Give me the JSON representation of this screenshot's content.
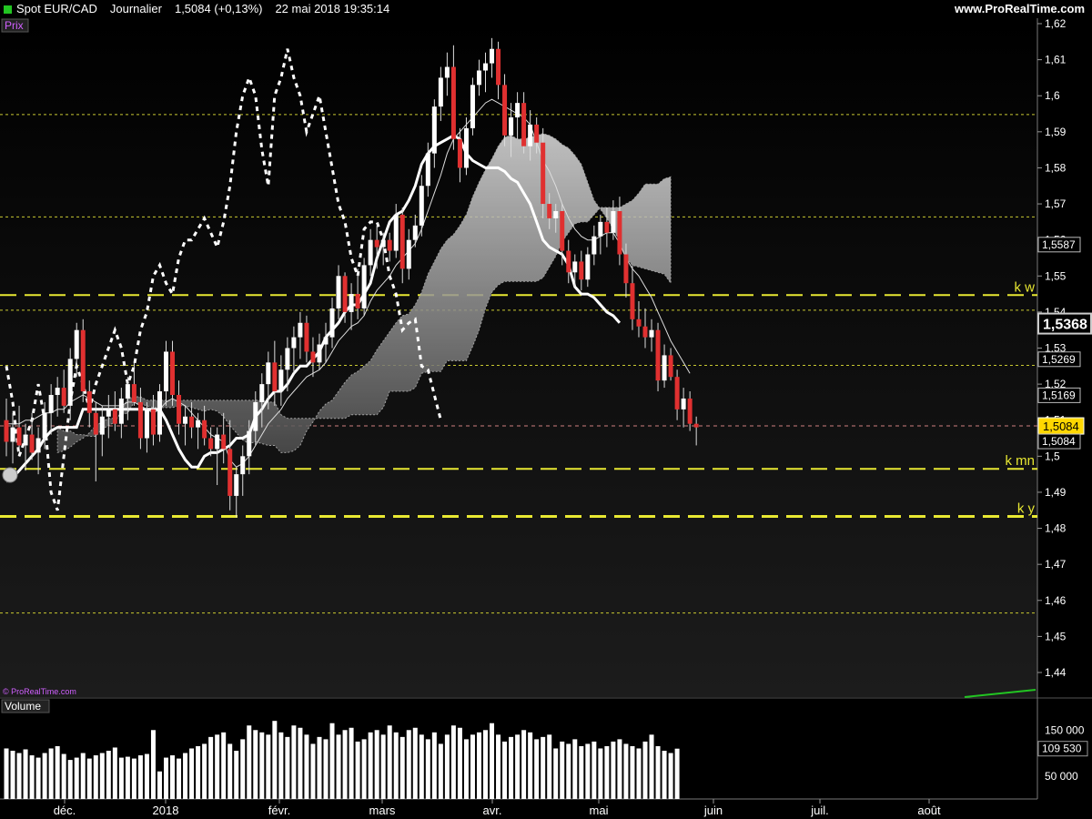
{
  "header": {
    "symbol": "Spot EUR/CAD",
    "period": "Journalier",
    "last": "1,5084 (+0,13%)",
    "datetime": "22 mai 2018 19:35:14",
    "site": "www.ProRealTime.com"
  },
  "panels": {
    "price_label": "Prix",
    "volume_label": "Volume",
    "watermark": "© ProRealTime.com"
  },
  "colors": {
    "background": "#0a0a0a",
    "up": "#ffffff",
    "down": "#e03030",
    "level_line": "#e8e832",
    "accent_green": "#22c522",
    "label_yellow": "#ffd700"
  },
  "chart_data": {
    "type": "line",
    "instrument": "Spot EUR/CAD",
    "x_labels": [
      "déc.",
      "2018",
      "févr.",
      "mars",
      "avr.",
      "mai",
      "juin",
      "juil.",
      "août"
    ],
    "y_ticks": [
      "1,44",
      "1,45",
      "1,46",
      "1,47",
      "1,48",
      "1,49",
      "1,5",
      "1,51",
      "1,52",
      "1,53",
      "1,54",
      "1,55",
      "1,56",
      "1,57",
      "1,58",
      "1,59",
      "1,6",
      "1,61",
      "1,62"
    ],
    "ylim": [
      1.435,
      1.622
    ],
    "price_tags": [
      {
        "text": "1,5587",
        "value": 1.5587,
        "style": "box"
      },
      {
        "text": "1,5368",
        "value": 1.5368,
        "style": "large"
      },
      {
        "text": "1,5269",
        "value": 1.5269,
        "style": "box"
      },
      {
        "text": "1,5169",
        "value": 1.5169,
        "style": "box"
      },
      {
        "text": "1,5084",
        "value": 1.5084,
        "style": "yellow"
      },
      {
        "text": "1,5084",
        "value": 1.5084,
        "style": "box"
      }
    ],
    "levels": [
      {
        "label": "k w",
        "value": 1.5447,
        "style": "dashed-bold"
      },
      {
        "label": "k mn",
        "value": 1.4965,
        "style": "dashed-bold"
      },
      {
        "label": "k y",
        "value": 1.4833,
        "style": "dashed-bold"
      },
      {
        "label": "",
        "value": 1.5948,
        "style": "dotted"
      },
      {
        "label": "",
        "value": 1.5664,
        "style": "dotted"
      },
      {
        "label": "",
        "value": 1.5405,
        "style": "dotted"
      },
      {
        "label": "",
        "value": 1.5252,
        "style": "dotted"
      },
      {
        "label": "",
        "value": 1.4565,
        "style": "dotted"
      }
    ],
    "last_price": 1.5084,
    "candles": [
      {
        "o": 1.51,
        "h": 1.516,
        "l": 1.5,
        "c": 1.504
      },
      {
        "o": 1.504,
        "h": 1.512,
        "l": 1.498,
        "c": 1.508
      },
      {
        "o": 1.508,
        "h": 1.514,
        "l": 1.502,
        "c": 1.503
      },
      {
        "o": 1.503,
        "h": 1.509,
        "l": 1.496,
        "c": 1.506
      },
      {
        "o": 1.506,
        "h": 1.512,
        "l": 1.499,
        "c": 1.501
      },
      {
        "o": 1.501,
        "h": 1.508,
        "l": 1.495,
        "c": 1.505
      },
      {
        "o": 1.505,
        "h": 1.515,
        "l": 1.502,
        "c": 1.512
      },
      {
        "o": 1.512,
        "h": 1.52,
        "l": 1.506,
        "c": 1.517
      },
      {
        "o": 1.517,
        "h": 1.522,
        "l": 1.511,
        "c": 1.519
      },
      {
        "o": 1.519,
        "h": 1.524,
        "l": 1.512,
        "c": 1.514
      },
      {
        "o": 1.514,
        "h": 1.53,
        "l": 1.51,
        "c": 1.527
      },
      {
        "o": 1.527,
        "h": 1.537,
        "l": 1.522,
        "c": 1.535
      },
      {
        "o": 1.535,
        "h": 1.538,
        "l": 1.515,
        "c": 1.518
      },
      {
        "o": 1.518,
        "h": 1.521,
        "l": 1.508,
        "c": 1.512
      },
      {
        "o": 1.512,
        "h": 1.515,
        "l": 1.493,
        "c": 1.506
      },
      {
        "o": 1.506,
        "h": 1.514,
        "l": 1.5,
        "c": 1.511
      },
      {
        "o": 1.511,
        "h": 1.517,
        "l": 1.505,
        "c": 1.513
      },
      {
        "o": 1.513,
        "h": 1.518,
        "l": 1.507,
        "c": 1.509
      },
      {
        "o": 1.509,
        "h": 1.519,
        "l": 1.505,
        "c": 1.516
      },
      {
        "o": 1.516,
        "h": 1.522,
        "l": 1.51,
        "c": 1.52
      },
      {
        "o": 1.52,
        "h": 1.526,
        "l": 1.514,
        "c": 1.515
      },
      {
        "o": 1.515,
        "h": 1.519,
        "l": 1.502,
        "c": 1.505
      },
      {
        "o": 1.505,
        "h": 1.515,
        "l": 1.501,
        "c": 1.513
      },
      {
        "o": 1.513,
        "h": 1.517,
        "l": 1.503,
        "c": 1.506
      },
      {
        "o": 1.506,
        "h": 1.52,
        "l": 1.504,
        "c": 1.518
      },
      {
        "o": 1.518,
        "h": 1.532,
        "l": 1.514,
        "c": 1.529
      },
      {
        "o": 1.529,
        "h": 1.532,
        "l": 1.514,
        "c": 1.517
      },
      {
        "o": 1.517,
        "h": 1.521,
        "l": 1.506,
        "c": 1.509
      },
      {
        "o": 1.509,
        "h": 1.514,
        "l": 1.503,
        "c": 1.511
      },
      {
        "o": 1.511,
        "h": 1.515,
        "l": 1.505,
        "c": 1.508
      },
      {
        "o": 1.508,
        "h": 1.512,
        "l": 1.502,
        "c": 1.51
      },
      {
        "o": 1.51,
        "h": 1.514,
        "l": 1.503,
        "c": 1.505
      },
      {
        "o": 1.505,
        "h": 1.508,
        "l": 1.5,
        "c": 1.502
      },
      {
        "o": 1.502,
        "h": 1.508,
        "l": 1.492,
        "c": 1.506
      },
      {
        "o": 1.506,
        "h": 1.512,
        "l": 1.498,
        "c": 1.502
      },
      {
        "o": 1.502,
        "h": 1.51,
        "l": 1.485,
        "c": 1.489
      },
      {
        "o": 1.489,
        "h": 1.497,
        "l": 1.483,
        "c": 1.495
      },
      {
        "o": 1.495,
        "h": 1.503,
        "l": 1.489,
        "c": 1.5
      },
      {
        "o": 1.5,
        "h": 1.51,
        "l": 1.495,
        "c": 1.507
      },
      {
        "o": 1.507,
        "h": 1.518,
        "l": 1.503,
        "c": 1.515
      },
      {
        "o": 1.515,
        "h": 1.523,
        "l": 1.508,
        "c": 1.52
      },
      {
        "o": 1.52,
        "h": 1.529,
        "l": 1.513,
        "c": 1.526
      },
      {
        "o": 1.526,
        "h": 1.532,
        "l": 1.514,
        "c": 1.518
      },
      {
        "o": 1.518,
        "h": 1.528,
        "l": 1.514,
        "c": 1.524
      },
      {
        "o": 1.524,
        "h": 1.533,
        "l": 1.518,
        "c": 1.53
      },
      {
        "o": 1.53,
        "h": 1.536,
        "l": 1.523,
        "c": 1.533
      },
      {
        "o": 1.533,
        "h": 1.54,
        "l": 1.527,
        "c": 1.537
      },
      {
        "o": 1.537,
        "h": 1.539,
        "l": 1.526,
        "c": 1.529
      },
      {
        "o": 1.529,
        "h": 1.533,
        "l": 1.522,
        "c": 1.526
      },
      {
        "o": 1.526,
        "h": 1.534,
        "l": 1.524,
        "c": 1.531
      },
      {
        "o": 1.531,
        "h": 1.537,
        "l": 1.526,
        "c": 1.533
      },
      {
        "o": 1.533,
        "h": 1.544,
        "l": 1.53,
        "c": 1.541
      },
      {
        "o": 1.541,
        "h": 1.553,
        "l": 1.538,
        "c": 1.55
      },
      {
        "o": 1.55,
        "h": 1.551,
        "l": 1.537,
        "c": 1.54
      },
      {
        "o": 1.54,
        "h": 1.548,
        "l": 1.535,
        "c": 1.545
      },
      {
        "o": 1.545,
        "h": 1.552,
        "l": 1.538,
        "c": 1.541
      },
      {
        "o": 1.541,
        "h": 1.555,
        "l": 1.539,
        "c": 1.553
      },
      {
        "o": 1.553,
        "h": 1.563,
        "l": 1.55,
        "c": 1.56
      },
      {
        "o": 1.56,
        "h": 1.564,
        "l": 1.552,
        "c": 1.558
      },
      {
        "o": 1.558,
        "h": 1.562,
        "l": 1.553,
        "c": 1.56
      },
      {
        "o": 1.56,
        "h": 1.562,
        "l": 1.554,
        "c": 1.557
      },
      {
        "o": 1.557,
        "h": 1.57,
        "l": 1.555,
        "c": 1.567
      },
      {
        "o": 1.567,
        "h": 1.569,
        "l": 1.548,
        "c": 1.552
      },
      {
        "o": 1.552,
        "h": 1.563,
        "l": 1.549,
        "c": 1.56
      },
      {
        "o": 1.56,
        "h": 1.567,
        "l": 1.558,
        "c": 1.564
      },
      {
        "o": 1.564,
        "h": 1.578,
        "l": 1.561,
        "c": 1.575
      },
      {
        "o": 1.575,
        "h": 1.587,
        "l": 1.572,
        "c": 1.584
      },
      {
        "o": 1.584,
        "h": 1.599,
        "l": 1.58,
        "c": 1.597
      },
      {
        "o": 1.597,
        "h": 1.608,
        "l": 1.593,
        "c": 1.605
      },
      {
        "o": 1.605,
        "h": 1.612,
        "l": 1.6,
        "c": 1.608
      },
      {
        "o": 1.608,
        "h": 1.614,
        "l": 1.585,
        "c": 1.588
      },
      {
        "o": 1.588,
        "h": 1.591,
        "l": 1.576,
        "c": 1.58
      },
      {
        "o": 1.58,
        "h": 1.594,
        "l": 1.578,
        "c": 1.591
      },
      {
        "o": 1.591,
        "h": 1.605,
        "l": 1.589,
        "c": 1.603
      },
      {
        "o": 1.603,
        "h": 1.61,
        "l": 1.6,
        "c": 1.607
      },
      {
        "o": 1.607,
        "h": 1.612,
        "l": 1.601,
        "c": 1.609
      },
      {
        "o": 1.609,
        "h": 1.616,
        "l": 1.605,
        "c": 1.613
      },
      {
        "o": 1.613,
        "h": 1.615,
        "l": 1.599,
        "c": 1.603
      },
      {
        "o": 1.603,
        "h": 1.606,
        "l": 1.586,
        "c": 1.589
      },
      {
        "o": 1.589,
        "h": 1.598,
        "l": 1.583,
        "c": 1.594
      },
      {
        "o": 1.594,
        "h": 1.601,
        "l": 1.588,
        "c": 1.598
      },
      {
        "o": 1.598,
        "h": 1.601,
        "l": 1.584,
        "c": 1.586
      },
      {
        "o": 1.586,
        "h": 1.596,
        "l": 1.582,
        "c": 1.592
      },
      {
        "o": 1.592,
        "h": 1.594,
        "l": 1.584,
        "c": 1.587
      },
      {
        "o": 1.587,
        "h": 1.591,
        "l": 1.566,
        "c": 1.57
      },
      {
        "o": 1.57,
        "h": 1.573,
        "l": 1.563,
        "c": 1.566
      },
      {
        "o": 1.566,
        "h": 1.57,
        "l": 1.562,
        "c": 1.568
      },
      {
        "o": 1.568,
        "h": 1.57,
        "l": 1.553,
        "c": 1.557
      },
      {
        "o": 1.557,
        "h": 1.56,
        "l": 1.548,
        "c": 1.551
      },
      {
        "o": 1.551,
        "h": 1.556,
        "l": 1.547,
        "c": 1.554
      },
      {
        "o": 1.554,
        "h": 1.557,
        "l": 1.546,
        "c": 1.549
      },
      {
        "o": 1.549,
        "h": 1.558,
        "l": 1.547,
        "c": 1.556
      },
      {
        "o": 1.556,
        "h": 1.564,
        "l": 1.553,
        "c": 1.561
      },
      {
        "o": 1.561,
        "h": 1.567,
        "l": 1.556,
        "c": 1.565
      },
      {
        "o": 1.565,
        "h": 1.569,
        "l": 1.558,
        "c": 1.562
      },
      {
        "o": 1.562,
        "h": 1.571,
        "l": 1.56,
        "c": 1.568
      },
      {
        "o": 1.568,
        "h": 1.572,
        "l": 1.553,
        "c": 1.556
      },
      {
        "o": 1.556,
        "h": 1.559,
        "l": 1.544,
        "c": 1.548
      },
      {
        "o": 1.548,
        "h": 1.553,
        "l": 1.535,
        "c": 1.538
      },
      {
        "o": 1.538,
        "h": 1.543,
        "l": 1.533,
        "c": 1.536
      },
      {
        "o": 1.536,
        "h": 1.541,
        "l": 1.53,
        "c": 1.533
      },
      {
        "o": 1.533,
        "h": 1.538,
        "l": 1.529,
        "c": 1.535
      },
      {
        "o": 1.535,
        "h": 1.537,
        "l": 1.518,
        "c": 1.521
      },
      {
        "o": 1.521,
        "h": 1.531,
        "l": 1.519,
        "c": 1.528
      },
      {
        "o": 1.528,
        "h": 1.53,
        "l": 1.521,
        "c": 1.522
      },
      {
        "o": 1.522,
        "h": 1.524,
        "l": 1.51,
        "c": 1.513
      },
      {
        "o": 1.513,
        "h": 1.519,
        "l": 1.508,
        "c": 1.516
      },
      {
        "o": 1.516,
        "h": 1.518,
        "l": 1.507,
        "c": 1.509
      },
      {
        "o": 1.509,
        "h": 1.511,
        "l": 1.503,
        "c": 1.508
      }
    ],
    "tenkan": [
      [
        1.509,
        1.509,
        1.509,
        1.51,
        1.51,
        1.511,
        1.512,
        1.512,
        1.513,
        1.513,
        1.515,
        1.516,
        1.517,
        1.516,
        1.515,
        1.514,
        1.514,
        1.514,
        1.514,
        1.515,
        1.515,
        1.514,
        1.513,
        1.512,
        1.513,
        1.515,
        1.516,
        1.515,
        1.514,
        1.512,
        1.51,
        1.508,
        1.506,
        1.505,
        1.504,
        1.499,
        1.497,
        1.498,
        1.5,
        1.503,
        1.506,
        1.509,
        1.511,
        1.513,
        1.516,
        1.518,
        1.52,
        1.522,
        1.523,
        1.524,
        1.526,
        1.529,
        1.532,
        1.534,
        1.536,
        1.537,
        1.539,
        1.543,
        1.546,
        1.548,
        1.55,
        1.553,
        1.555,
        1.557,
        1.559,
        1.563,
        1.568,
        1.573,
        1.578,
        1.584,
        1.588,
        1.59,
        1.592,
        1.594,
        1.596,
        1.598,
        1.599,
        1.598,
        1.597,
        1.596,
        1.595,
        1.594,
        1.592,
        1.587,
        1.582,
        1.579,
        1.575,
        1.57,
        1.566,
        1.563,
        1.561,
        1.56,
        1.56,
        1.561,
        1.562,
        1.562,
        1.559,
        1.555,
        1.552,
        1.55,
        1.547,
        1.544,
        1.54,
        1.536,
        1.532,
        1.529,
        1.526,
        1.523
      ]
    ],
    "kijun": [
      1.493,
      1.494,
      1.496,
      1.498,
      1.5,
      1.502,
      1.505,
      1.507,
      1.508,
      1.508,
      1.508,
      1.508,
      1.513,
      1.513,
      1.513,
      1.513,
      1.513,
      1.513,
      1.513,
      1.513,
      1.513,
      1.513,
      1.513,
      1.513,
      1.513,
      1.51,
      1.506,
      1.502,
      1.499,
      1.497,
      1.497,
      1.5,
      1.501,
      1.501,
      1.502,
      1.503,
      1.505,
      1.505,
      1.506,
      1.511,
      1.513,
      1.516,
      1.518,
      1.518,
      1.52,
      1.523,
      1.525,
      1.525,
      1.527,
      1.529,
      1.533,
      1.535,
      1.537,
      1.54,
      1.542,
      1.542,
      1.545,
      1.548,
      1.555,
      1.56,
      1.565,
      1.567,
      1.568,
      1.571,
      1.575,
      1.581,
      1.584,
      1.586,
      1.587,
      1.588,
      1.589,
      1.588,
      1.584,
      1.582,
      1.581,
      1.58,
      1.58,
      1.58,
      1.579,
      1.577,
      1.576,
      1.573,
      1.57,
      1.565,
      1.56,
      1.558,
      1.557,
      1.556,
      1.553,
      1.547,
      1.545,
      1.545,
      1.544,
      1.542,
      1.54,
      1.539,
      1.537
    ],
    "chikou": [
      1.525,
      1.515,
      1.5,
      1.505,
      1.51,
      1.52,
      1.51,
      1.49,
      1.485,
      1.5,
      1.515,
      1.525,
      1.52,
      1.513,
      1.52,
      1.525,
      1.53,
      1.535,
      1.53,
      1.52,
      1.525,
      1.535,
      1.54,
      1.55,
      1.553,
      1.548,
      1.545,
      1.555,
      1.56,
      1.56,
      1.563,
      1.566,
      1.562,
      1.558,
      1.565,
      1.575,
      1.59,
      1.6,
      1.605,
      1.6,
      1.585,
      1.575,
      1.6,
      1.605,
      1.613,
      1.605,
      1.6,
      1.59,
      1.595,
      1.6,
      1.59,
      1.58,
      1.57,
      1.565,
      1.555,
      1.55,
      1.563,
      1.565,
      1.565,
      1.56,
      1.55,
      1.545,
      1.535,
      1.537,
      1.538,
      1.525,
      1.524,
      1.517,
      1.51
    ],
    "volume_ticks": [
      "150 000",
      "50 000"
    ],
    "volume_tag": "109 530",
    "volume_max": 210000,
    "volumes": [
      110000,
      105000,
      100000,
      108000,
      95000,
      90000,
      100000,
      110000,
      115000,
      98000,
      85000,
      90000,
      100000,
      88000,
      95000,
      100000,
      105000,
      112000,
      90000,
      92000,
      88000,
      95000,
      98000,
      150000,
      60000,
      90000,
      95000,
      88000,
      100000,
      110000,
      115000,
      120000,
      135000,
      140000,
      145000,
      120000,
      105000,
      130000,
      160000,
      150000,
      145000,
      140000,
      170000,
      145000,
      135000,
      160000,
      155000,
      140000,
      120000,
      135000,
      130000,
      165000,
      140000,
      150000,
      155000,
      125000,
      130000,
      145000,
      150000,
      140000,
      160000,
      145000,
      135000,
      150000,
      155000,
      140000,
      130000,
      145000,
      120000,
      140000,
      160000,
      155000,
      130000,
      140000,
      145000,
      150000,
      165000,
      140000,
      125000,
      135000,
      140000,
      150000,
      145000,
      130000,
      135000,
      140000,
      110000,
      125000,
      120000,
      130000,
      115000,
      120000,
      125000,
      110000,
      115000,
      125000,
      130000,
      120000,
      115000,
      110000,
      125000,
      140000,
      115000,
      105000,
      100000,
      109530
    ]
  }
}
